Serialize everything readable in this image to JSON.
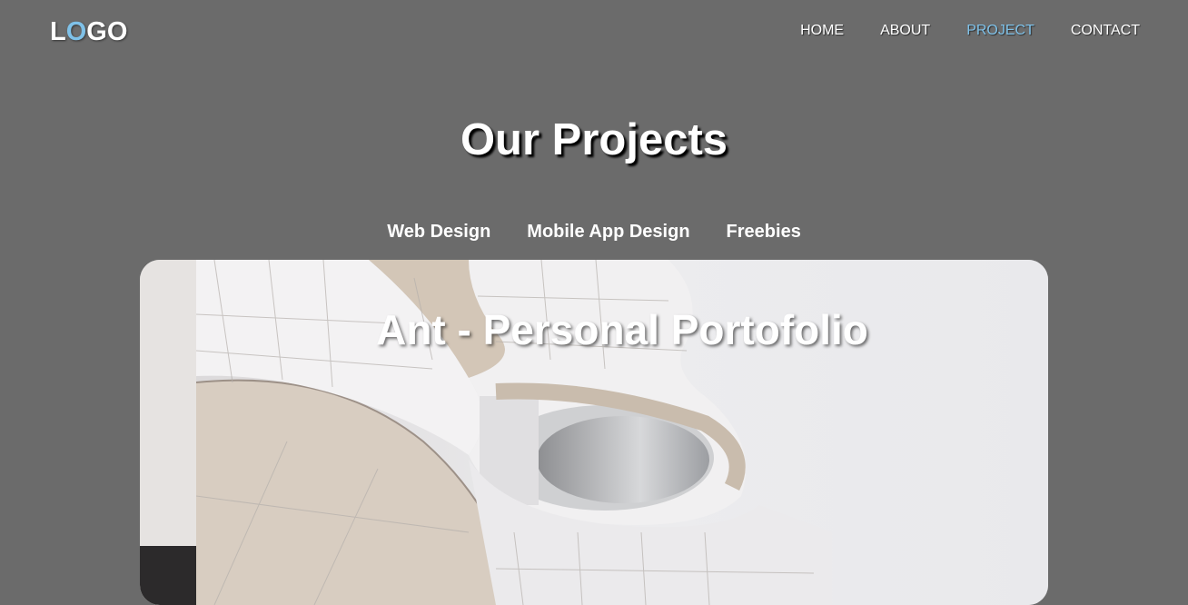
{
  "header": {
    "logo": {
      "first": "L",
      "accent": "O",
      "rest": "GO"
    },
    "nav": [
      {
        "label": "HOME",
        "active": false
      },
      {
        "label": "ABOUT",
        "active": false
      },
      {
        "label": "PROJECT",
        "active": true
      },
      {
        "label": "CONTACT",
        "active": false
      }
    ]
  },
  "main": {
    "title": "Our Projects",
    "filters": [
      "Web Design",
      "Mobile App Design",
      "Freebies"
    ],
    "card": {
      "title": "Ant - Personal Portofolio",
      "image_icon": "architecture-photo"
    }
  },
  "colors": {
    "background": "#6b6b6b",
    "accent": "#7fc1e8",
    "text": "#ffffff"
  }
}
